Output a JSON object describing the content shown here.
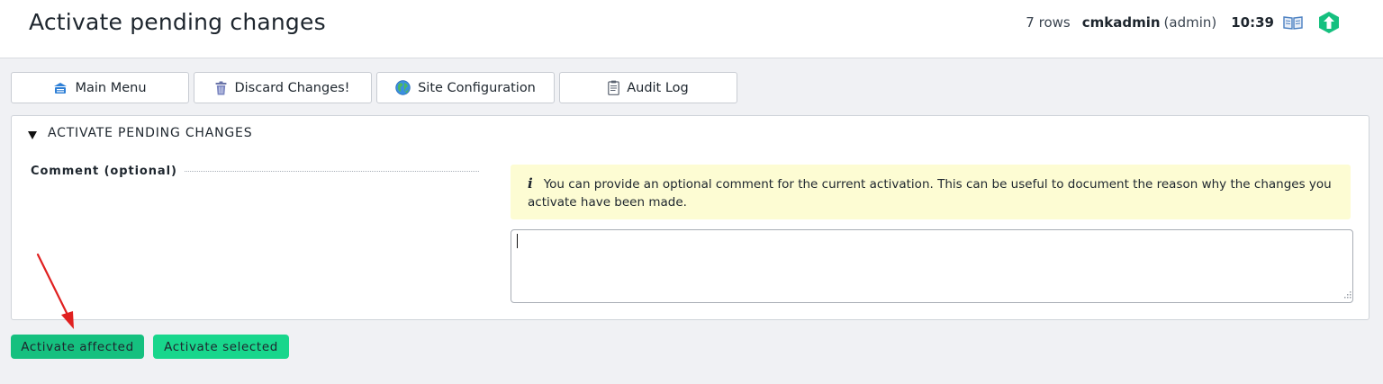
{
  "header": {
    "title": "Activate pending changes",
    "rows": "7 rows",
    "user": "cmkadmin",
    "role": "(admin)",
    "time": "10:39"
  },
  "nav_buttons": [
    {
      "label": "Main Menu",
      "icon": "main-menu-icon"
    },
    {
      "label": "Discard Changes!",
      "icon": "trash-icon"
    },
    {
      "label": "Site Configuration",
      "icon": "globe-icon"
    },
    {
      "label": "Audit Log",
      "icon": "clipboard-icon"
    }
  ],
  "panel": {
    "fold_title": "ACTIVATE PENDING CHANGES",
    "comment_label": "Comment (optional)",
    "help_text": "You can provide an optional comment for the current activation. This can be useful to document the reason why the changes you activate have been made.",
    "comment_value": ""
  },
  "actions": {
    "affected": "Activate affected",
    "selected": "Activate selected"
  },
  "colors": {
    "accent": "#15c07f",
    "accent_light": "#18d68c",
    "help_bg": "#fdfcd3",
    "annotation_arrow": "#e02020"
  }
}
